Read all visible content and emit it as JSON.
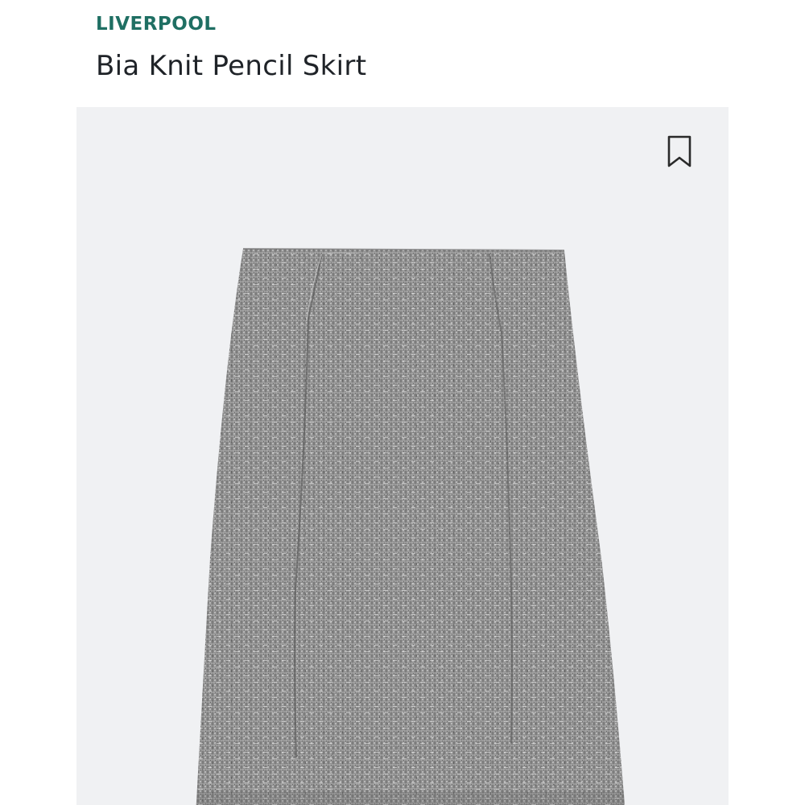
{
  "product": {
    "brand": "LIVERPOOL",
    "title": "Bia Knit Pencil Skirt"
  },
  "icons": {
    "bookmark": "bookmark-icon"
  },
  "colors": {
    "brand": "#1f6f63",
    "title": "#1f2328",
    "image_background": "#f0f1f3",
    "fabric": "#8e8e8e"
  }
}
